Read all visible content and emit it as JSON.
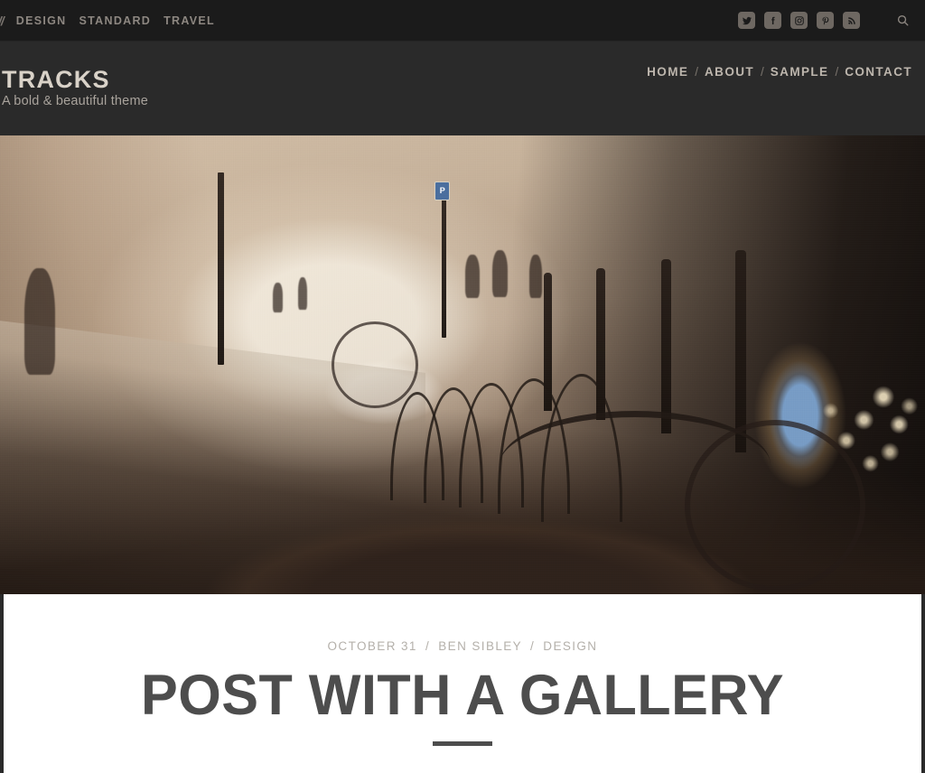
{
  "topbar": {
    "slashes": "//",
    "categories": [
      {
        "label": "DESIGN",
        "name": "design"
      },
      {
        "label": "STANDARD",
        "name": "standard"
      },
      {
        "label": "TRAVEL",
        "name": "travel"
      }
    ],
    "social": [
      {
        "label": "Twitter",
        "icon": "twitter-icon"
      },
      {
        "label": "Facebook",
        "icon": "facebook-icon"
      },
      {
        "label": "Instagram",
        "icon": "instagram-icon"
      },
      {
        "label": "Pinterest",
        "icon": "pinterest-icon"
      },
      {
        "label": "RSS",
        "icon": "rss-icon"
      }
    ],
    "search_label": "Search"
  },
  "header": {
    "site_title": "TRACKS",
    "tagline": "A bold & beautiful theme",
    "nav": [
      {
        "label": "HOME"
      },
      {
        "label": "ABOUT"
      },
      {
        "label": "SAMPLE"
      },
      {
        "label": "CONTACT"
      }
    ],
    "nav_separator": "/"
  },
  "hero": {
    "alt": "Sepia-toned photo of a European street with bike racks, a parked car and a wicker bicycle basket in the foreground"
  },
  "post": {
    "date": "OCTOBER 31",
    "author": "BEN SIBLEY",
    "category": "DESIGN",
    "meta_separator": "/",
    "title": "POST WITH A GALLERY"
  },
  "colors": {
    "topbar_bg": "#1b1b1b",
    "header_bg": "#2a2a2a",
    "site_title": "#d9d2c8",
    "tagline": "#a9a39c",
    "nav_link": "#bdb6ad",
    "meta_text": "#b4b0aa",
    "post_title": "#4d4d4d",
    "content_bg": "#ffffff"
  }
}
